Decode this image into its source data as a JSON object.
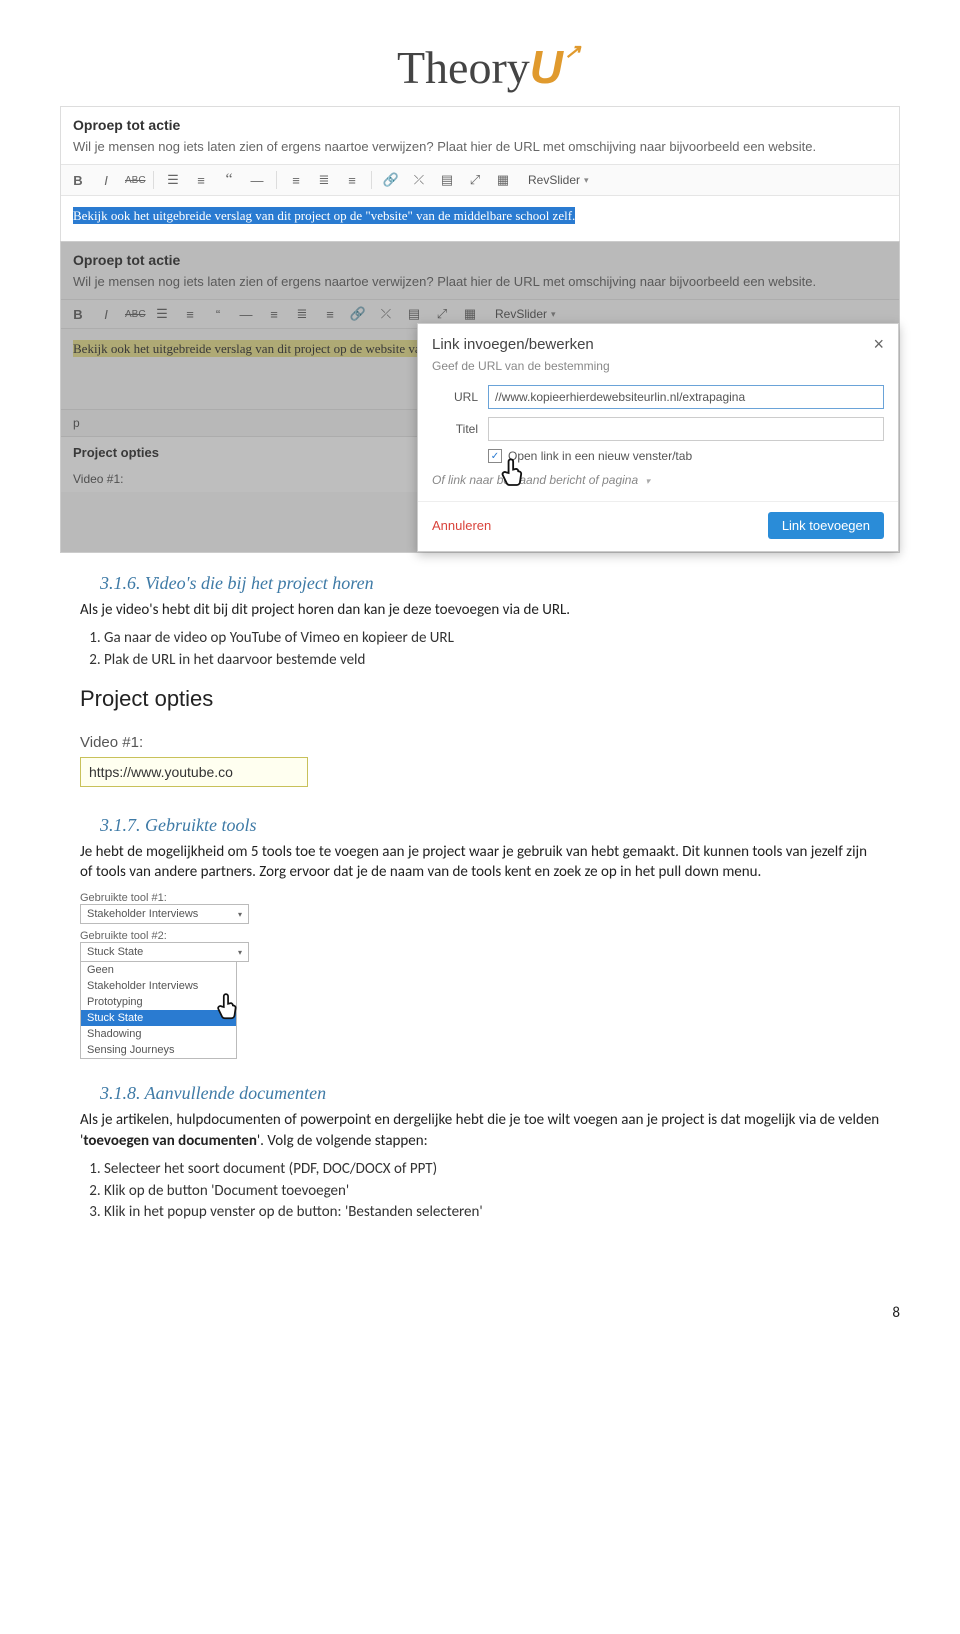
{
  "logo_text": "Theory",
  "logo_u": "U",
  "shot1": {
    "heading": "Oproep tot actie",
    "helper": "Wil je mensen nog iets laten zien of ergens naartoe verwijzen? Plaat hier de URL met omschijving naar bijvoorbeeld een website.",
    "toolbar_dropdown": "RevSlider",
    "content_highlight": "Bekijk ook het uitgebreide verslag van dit project op de \"vebsite\" van de middelbare school zelf."
  },
  "shot2": {
    "heading": "Oproep tot actie",
    "helper": "Wil je mensen nog iets laten zien of ergens naartoe verwijzen? Plaat hier de URL met omschijving naar bijvoorbeeld een website.",
    "toolbar_dropdown": "RevSlider",
    "content_highlight": "Bekijk ook het uitgebreide verslag van dit project op de website van de middelbare school zelf.",
    "path_p": "p",
    "proj_opts": "Project opties",
    "video1": "Video #1:",
    "dialog": {
      "title": "Link invoegen/bewerken",
      "sub": "Geef de URL van de bestemming",
      "url_label": "URL",
      "url_value": "//www.kopieerhierdewebsiteurlin.nl/extrapagina",
      "title_label": "Titel",
      "checkbox_label": "Open link in een nieuw venster/tab",
      "existing": "Of link naar bestaand bericht of pagina",
      "cancel": "Annuleren",
      "submit": "Link toevoegen"
    }
  },
  "sec316": {
    "title": "3.1.6. Video's die bij het project horen",
    "intro": "Als je video's hebt dit bij dit project horen dan kan je deze toevoegen via de URL.",
    "step1": "Ga naar de video op YouTube of Vimeo en kopieer de URL",
    "step2": "Plak de URL in het daarvoor bestemde veld",
    "proj_opts": "Project opties",
    "video1": "Video #1:",
    "url_sample": "https://www.youtube.co"
  },
  "sec317": {
    "title": "3.1.7. Gebruikte tools",
    "para": "Je hebt de mogelijkheid om 5 tools toe te voegen aan je project waar je gebruik van hebt gemaakt. Dit kunnen tools van jezelf zijn of tools van andere partners. Zorg ervoor dat je de naam van de tools kent en zoek ze op in het pull down menu.",
    "tool1_label": "Gebruikte tool #1:",
    "tool1_value": "Stakeholder Interviews",
    "tool2_label": "Gebruikte tool #2:",
    "tool2_sel": "Stuck State",
    "options": [
      "Geen",
      "Stakeholder Interviews",
      "Prototyping",
      "Stuck State",
      "Shadowing",
      "Sensing Journeys"
    ]
  },
  "sec318": {
    "title": "3.1.8. Aanvullende documenten",
    "para_a": "Als je artikelen, hulpdocumenten of powerpoint en dergelijke hebt die je toe wilt voegen aan je project is dat mogelijk via de velden '",
    "para_bold": "toevoegen van documenten",
    "para_b": "'. Volg de volgende stappen:",
    "step1": "Selecteer het soort document (PDF, DOC/DOCX of PPT)",
    "step2": "Klik op de button 'Document toevoegen'",
    "step3": "Klik in het popup venster op de button: 'Bestanden selecteren'"
  },
  "page_number": "8"
}
